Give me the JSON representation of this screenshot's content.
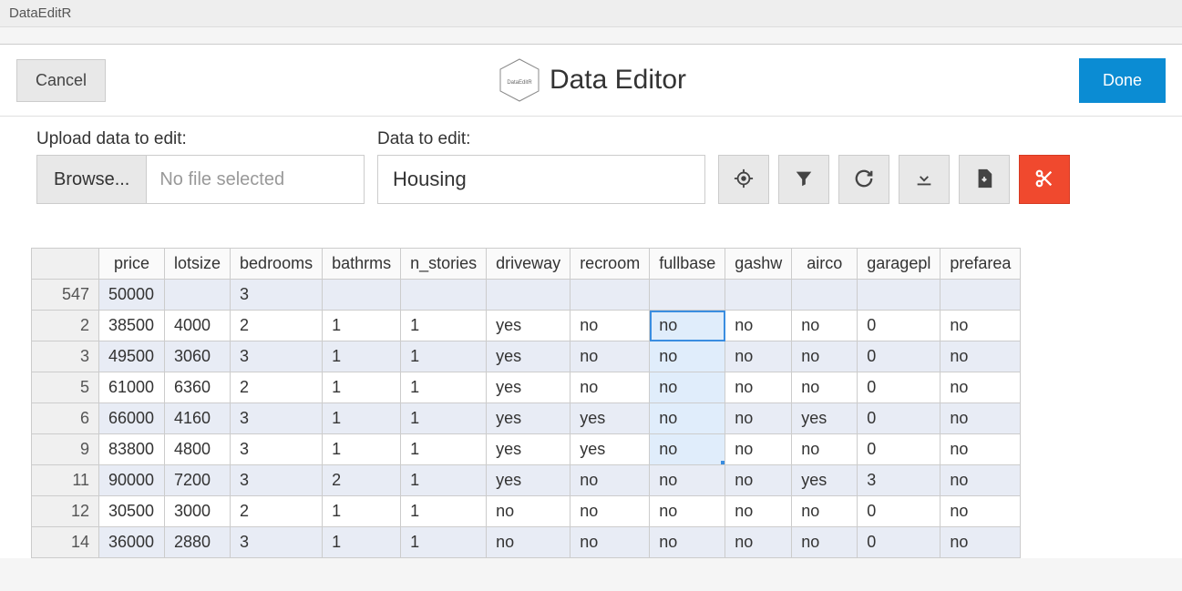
{
  "window": {
    "title": "DataEditR"
  },
  "header": {
    "cancel_label": "Cancel",
    "app_title": "Data Editor",
    "logo_text": "DataEditR",
    "done_label": "Done"
  },
  "controls": {
    "upload_label": "Upload data to edit:",
    "browse_label": "Browse...",
    "file_placeholder": "No file selected",
    "data_label": "Data to edit:",
    "data_value": "Housing"
  },
  "toolbar_icons": [
    "target-icon",
    "filter-icon",
    "refresh-icon",
    "download-icon",
    "export-icon",
    "cut-icon"
  ],
  "table": {
    "columns": [
      "",
      "price",
      "lotsize",
      "bedrooms",
      "bathrms",
      "n_stories",
      "driveway",
      "recroom",
      "fullbase",
      "gashw",
      "airco",
      "garagepl",
      "prefarea"
    ],
    "rows": [
      {
        "id": "547",
        "cells": [
          "50000",
          "",
          "3",
          "",
          "",
          "",
          "",
          "",
          "",
          "",
          "",
          ""
        ]
      },
      {
        "id": "2",
        "cells": [
          "38500",
          "4000",
          "2",
          "1",
          "1",
          "yes",
          "no",
          "no",
          "no",
          "no",
          "0",
          "no"
        ]
      },
      {
        "id": "3",
        "cells": [
          "49500",
          "3060",
          "3",
          "1",
          "1",
          "yes",
          "no",
          "no",
          "no",
          "no",
          "0",
          "no"
        ]
      },
      {
        "id": "5",
        "cells": [
          "61000",
          "6360",
          "2",
          "1",
          "1",
          "yes",
          "no",
          "no",
          "no",
          "no",
          "0",
          "no"
        ]
      },
      {
        "id": "6",
        "cells": [
          "66000",
          "4160",
          "3",
          "1",
          "1",
          "yes",
          "yes",
          "no",
          "no",
          "yes",
          "0",
          "no"
        ]
      },
      {
        "id": "9",
        "cells": [
          "83800",
          "4800",
          "3",
          "1",
          "1",
          "yes",
          "yes",
          "no",
          "no",
          "no",
          "0",
          "no"
        ]
      },
      {
        "id": "11",
        "cells": [
          "90000",
          "7200",
          "3",
          "2",
          "1",
          "yes",
          "no",
          "no",
          "no",
          "yes",
          "3",
          "no"
        ]
      },
      {
        "id": "12",
        "cells": [
          "30500",
          "3000",
          "2",
          "1",
          "1",
          "no",
          "no",
          "no",
          "no",
          "no",
          "0",
          "no"
        ]
      },
      {
        "id": "14",
        "cells": [
          "36000",
          "2880",
          "3",
          "1",
          "1",
          "no",
          "no",
          "no",
          "no",
          "no",
          "0",
          "no"
        ]
      }
    ],
    "selected_col": 8,
    "selected_row_start": 1,
    "selected_row_end": 5,
    "active_row": 1
  }
}
